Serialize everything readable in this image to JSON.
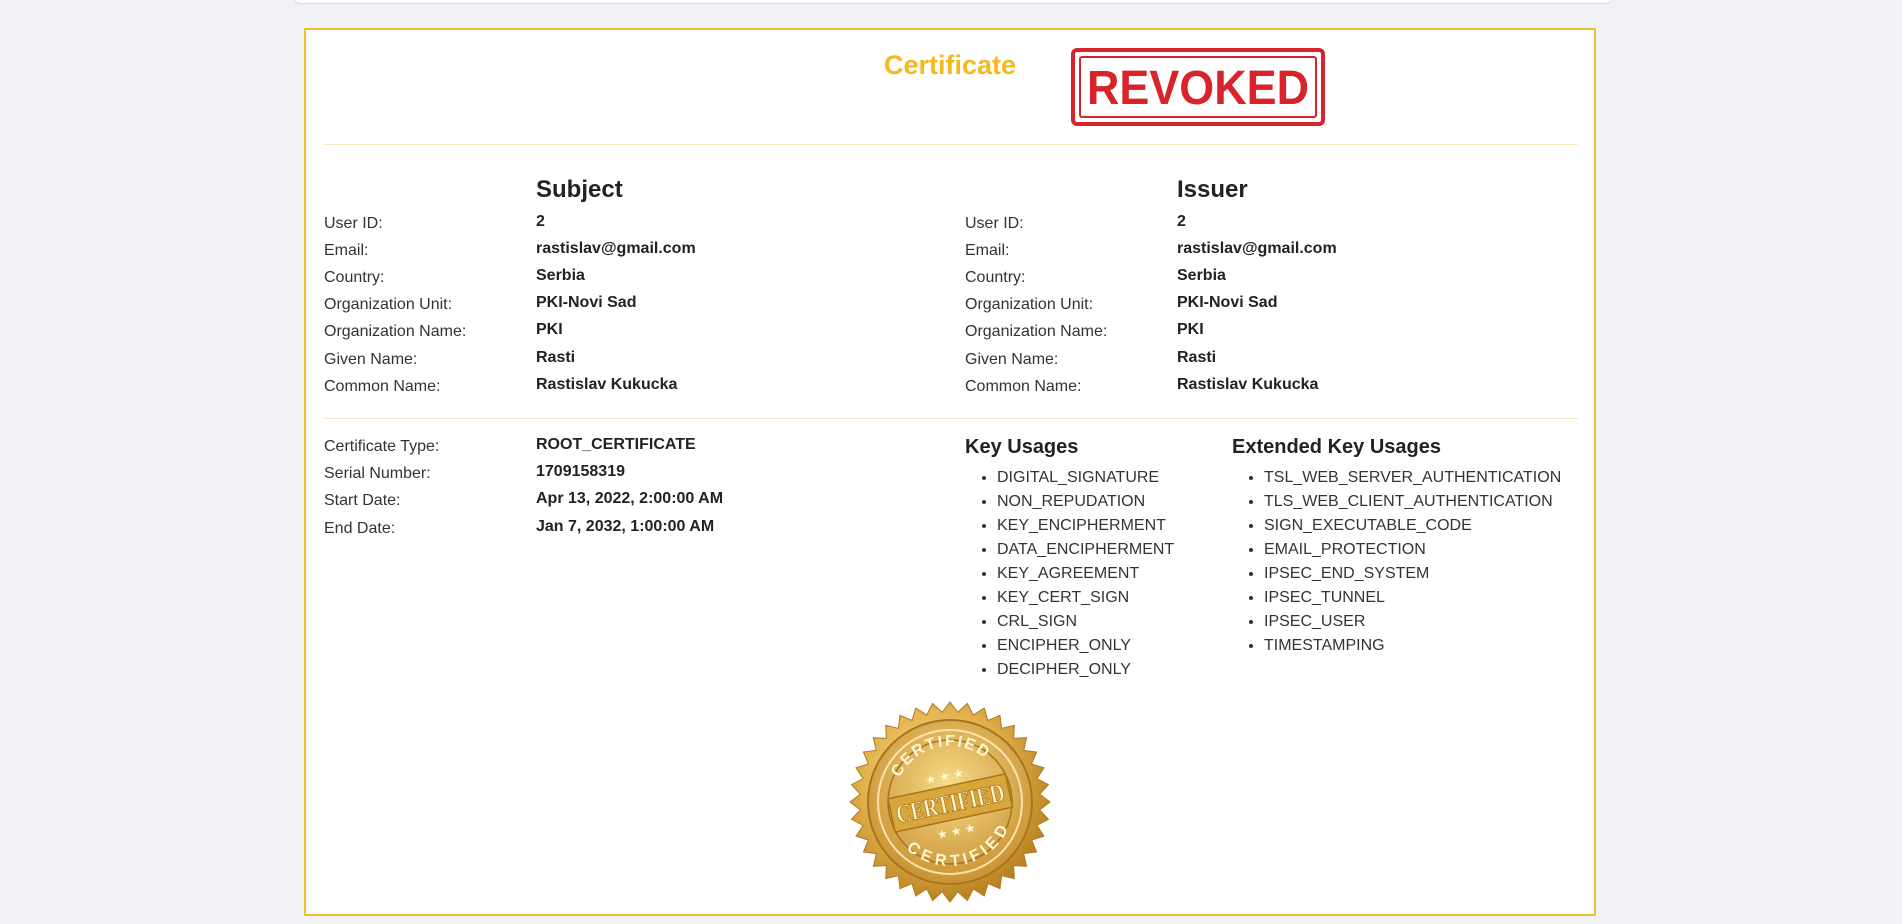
{
  "title": "Certificate",
  "status_stamp": "REVOKED",
  "seal_text": "CERTIFIED",
  "subject": {
    "heading": "Subject",
    "fields": [
      {
        "label": "User ID:",
        "value": "2"
      },
      {
        "label": "Email:",
        "value": "rastislav@gmail.com"
      },
      {
        "label": "Country:",
        "value": "Serbia"
      },
      {
        "label": "Organization Unit:",
        "value": "PKI-Novi Sad"
      },
      {
        "label": "Organization Name:",
        "value": "PKI"
      },
      {
        "label": "Given Name:",
        "value": "Rasti"
      },
      {
        "label": "Common Name:",
        "value": "Rastislav Kukucka"
      }
    ]
  },
  "issuer": {
    "heading": "Issuer",
    "fields": [
      {
        "label": "User ID:",
        "value": "2"
      },
      {
        "label": "Email:",
        "value": "rastislav@gmail.com"
      },
      {
        "label": "Country:",
        "value": "Serbia"
      },
      {
        "label": "Organization Unit:",
        "value": "PKI-Novi Sad"
      },
      {
        "label": "Organization Name:",
        "value": "PKI"
      },
      {
        "label": "Given Name:",
        "value": "Rasti"
      },
      {
        "label": "Common Name:",
        "value": "Rastislav Kukucka"
      }
    ]
  },
  "details": [
    {
      "label": "Certificate Type:",
      "value": "ROOT_CERTIFICATE"
    },
    {
      "label": "Serial Number:",
      "value": "1709158319"
    },
    {
      "label": "Start Date:",
      "value": "Apr 13, 2022, 2:00:00 AM"
    },
    {
      "label": "End Date:",
      "value": "Jan 7, 2032, 1:00:00 AM"
    }
  ],
  "key_usages": {
    "heading": "Key Usages",
    "items": [
      "DIGITAL_SIGNATURE",
      "NON_REPUDATION",
      "KEY_ENCIPHERMENT",
      "DATA_ENCIPHERMENT",
      "KEY_AGREEMENT",
      "KEY_CERT_SIGN",
      "CRL_SIGN",
      "ENCIPHER_ONLY",
      "DECIPHER_ONLY"
    ]
  },
  "extended_key_usages": {
    "heading": "Extended Key Usages",
    "items": [
      "TSL_WEB_SERVER_AUTHENTICATION",
      "TLS_WEB_CLIENT_AUTHENTICATION",
      "SIGN_EXECUTABLE_CODE",
      "EMAIL_PROTECTION",
      "IPSEC_END_SYSTEM",
      "IPSEC_TUNNEL",
      "IPSEC_USER",
      "TIMESTAMPING"
    ]
  },
  "colors": {
    "accent": "#f5b91e",
    "card_border": "#f5c026",
    "stamp_red": "#d8232a",
    "seal_gold": "#d9a63b",
    "page_bg": "#f1f2f6"
  }
}
